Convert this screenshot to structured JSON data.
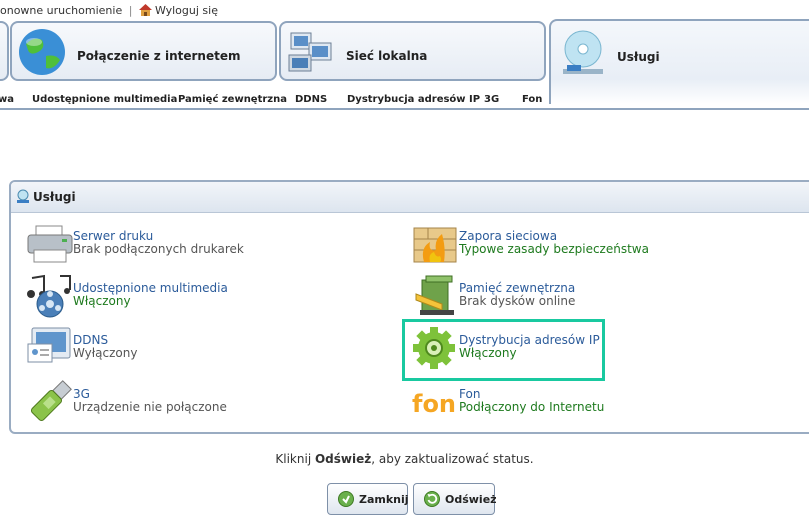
{
  "topbar": {
    "restart": "onowne uruchomienie",
    "separator": "|",
    "logout": "Wyloguj się"
  },
  "tabs": [
    {
      "label": "Połączenie z internetem"
    },
    {
      "label": "Sieć lokalna"
    },
    {
      "label": "Usługi"
    }
  ],
  "subnav": [
    "wa",
    "Udostępnione multimedia",
    "Pamięć zewnętrzna",
    "DDNS",
    "Dystrybucja adresów IP",
    "3G",
    "Fon"
  ],
  "panel": {
    "title": "Usługi"
  },
  "services": [
    {
      "name": "Serwer druku",
      "status": "Brak podłączonych drukarek",
      "status_kind": "gray"
    },
    {
      "name": "Zapora sieciowa",
      "status": "Typowe zasady bezpieczeństwa",
      "status_kind": "green"
    },
    {
      "name": "Udostępnione multimedia",
      "status": "Włączony",
      "status_kind": "green"
    },
    {
      "name": "Pamięć zewnętrzna",
      "status": "Brak dysków online",
      "status_kind": "gray"
    },
    {
      "name": "DDNS",
      "status": "Wyłączony",
      "status_kind": "gray"
    },
    {
      "name": "Dystrybucja adresów IP",
      "status": "Włączony",
      "status_kind": "green"
    },
    {
      "name": "3G",
      "status": "Urządzenie nie połączone",
      "status_kind": "gray"
    },
    {
      "name": "Fon",
      "status": "Podłączony do Internetu",
      "status_kind": "green"
    }
  ],
  "hint": {
    "before": "Kliknij ",
    "bold": "Odśwież",
    "after": ", aby zaktualizować status."
  },
  "buttons": {
    "close": "Zamknij",
    "refresh": "Odśwież"
  },
  "icons": {
    "fon_logo": "fon"
  },
  "colors": {
    "accent_border": "#8fa4bd",
    "link": "#2b5b9a",
    "status_green": "#1e7a1e",
    "highlight": "#19c9a0"
  }
}
